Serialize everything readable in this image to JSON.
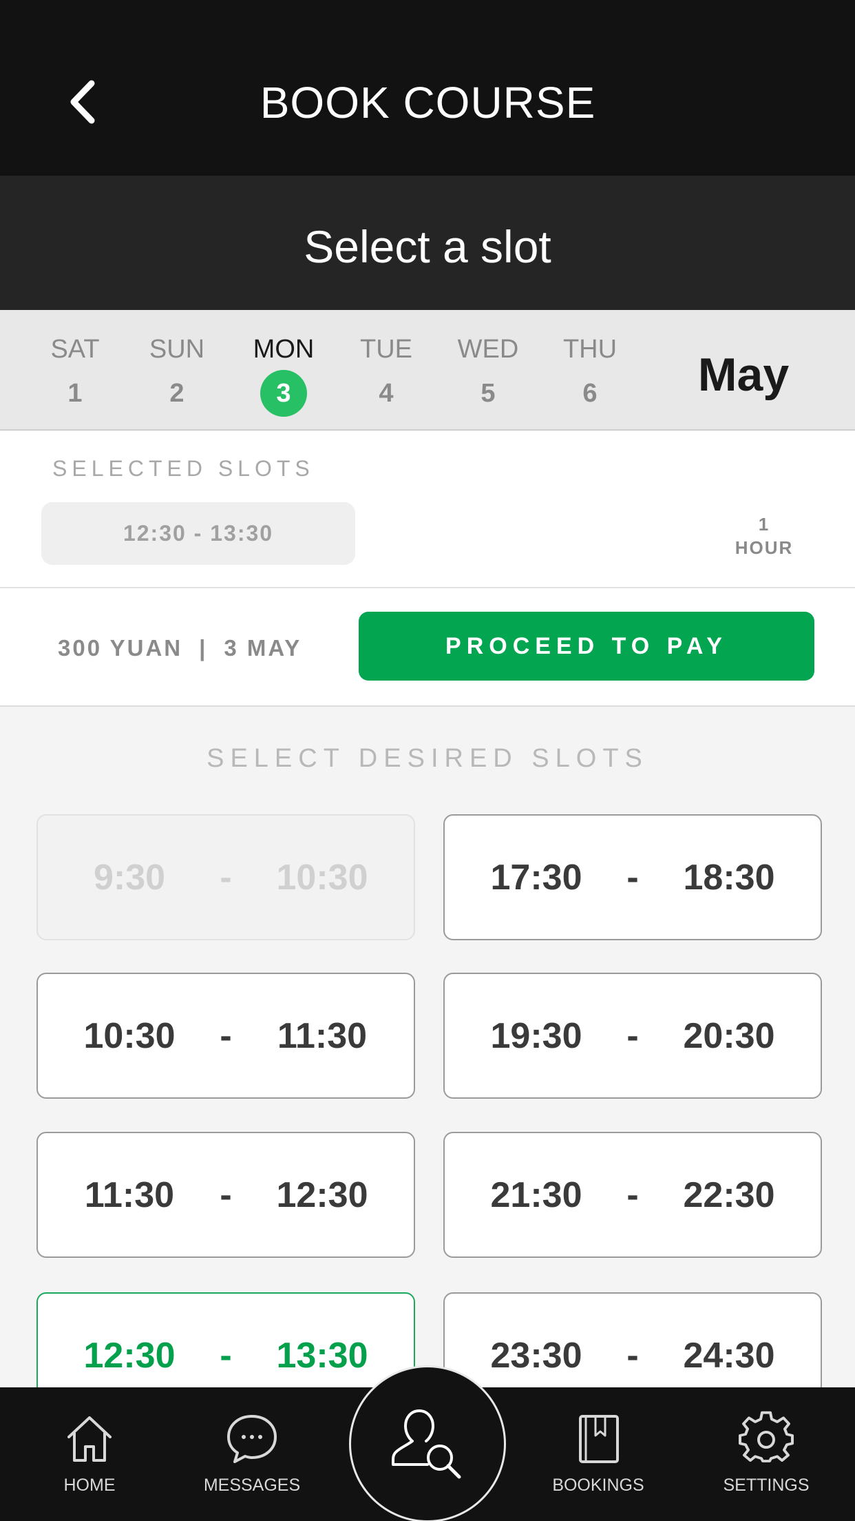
{
  "header": {
    "title": "BOOK COURSE",
    "back_icon": "chevron-left-icon"
  },
  "subheader": {
    "title": "Select a slot"
  },
  "calendar": {
    "month": "May",
    "days": [
      {
        "name": "SAT",
        "num": "1",
        "active": false
      },
      {
        "name": "SUN",
        "num": "2",
        "active": false
      },
      {
        "name": "MON",
        "num": "3",
        "active": true
      },
      {
        "name": "TUE",
        "num": "4",
        "active": false
      },
      {
        "name": "WED",
        "num": "5",
        "active": false
      },
      {
        "name": "THU",
        "num": "6",
        "active": false
      }
    ],
    "active_color": "#27c065"
  },
  "selected": {
    "label": "SELECTED SLOTS",
    "slot": "12:30 - 13:30",
    "duration_value": "1",
    "duration_unit": "HOUR"
  },
  "payment": {
    "price": "300 YUAN",
    "separator": "|",
    "date": "3 MAY",
    "button_label": "PROCEED TO PAY",
    "button_color": "#04a550"
  },
  "slots": {
    "label": "SELECT DESIRED SLOTS",
    "items": [
      {
        "start": "9:30",
        "end": "10:30",
        "state": "disabled"
      },
      {
        "start": "17:30",
        "end": "18:30",
        "state": "available"
      },
      {
        "start": "10:30",
        "end": "11:30",
        "state": "available"
      },
      {
        "start": "19:30",
        "end": "20:30",
        "state": "available"
      },
      {
        "start": "11:30",
        "end": "12:30",
        "state": "available"
      },
      {
        "start": "21:30",
        "end": "22:30",
        "state": "available"
      },
      {
        "start": "12:30",
        "end": "13:30",
        "state": "selected"
      },
      {
        "start": "23:30",
        "end": "24:30",
        "state": "available"
      }
    ],
    "dash": "-"
  },
  "nav": {
    "items": [
      {
        "label": "HOME",
        "icon": "home-icon"
      },
      {
        "label": "MESSAGES",
        "icon": "chat-bubble-icon"
      },
      {
        "label": "BOOKINGS",
        "icon": "book-icon"
      },
      {
        "label": "SETTINGS",
        "icon": "gear-icon"
      }
    ],
    "center_icon": "user-search-icon"
  }
}
